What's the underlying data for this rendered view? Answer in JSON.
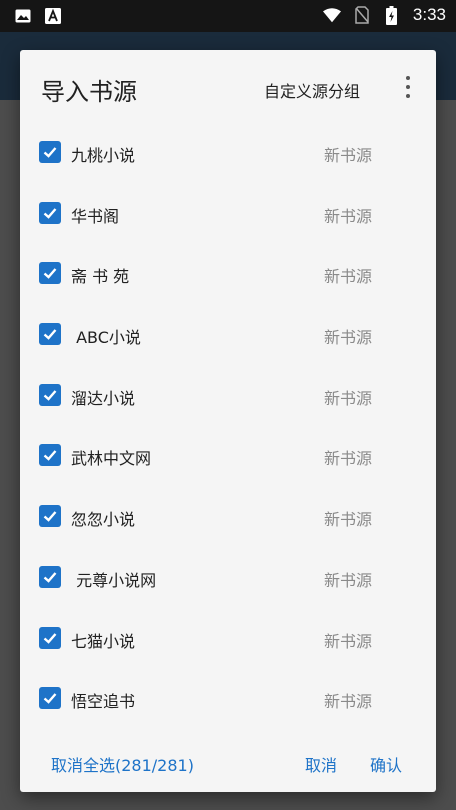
{
  "status_bar": {
    "time": "3:33",
    "icons": [
      "image-icon",
      "a-icon",
      "wifi-icon",
      "no-sim-icon",
      "battery-charging-icon"
    ]
  },
  "dialog": {
    "title": "导入书源",
    "action_label": "自定义源分组",
    "menu_icon": "more-vert-icon",
    "items": [
      {
        "name": "九桃小说",
        "tag": "新书源",
        "checked": true
      },
      {
        "name": "华书阁",
        "tag": "新书源",
        "checked": true
      },
      {
        "name": "斋 书 苑",
        "tag": "新书源",
        "checked": true
      },
      {
        "name": " ABC小说",
        "tag": "新书源",
        "checked": true
      },
      {
        "name": "溜达小说",
        "tag": "新书源",
        "checked": true
      },
      {
        "name": "武林中文网",
        "tag": "新书源",
        "checked": true
      },
      {
        "name": "忽忽小说",
        "tag": "新书源",
        "checked": true
      },
      {
        "name": " 元尊小说网",
        "tag": "新书源",
        "checked": true
      },
      {
        "name": "七猫小说",
        "tag": "新书源",
        "checked": true
      },
      {
        "name": "悟空追书",
        "tag": "新书源",
        "checked": true
      }
    ],
    "deselect_all_label": "取消全选(281/281)",
    "cancel_label": "取消",
    "confirm_label": "确认"
  },
  "colors": {
    "accent": "#1e73c8",
    "dialog_bg": "#f5f5f5",
    "tag_text": "#8a8a8a"
  }
}
